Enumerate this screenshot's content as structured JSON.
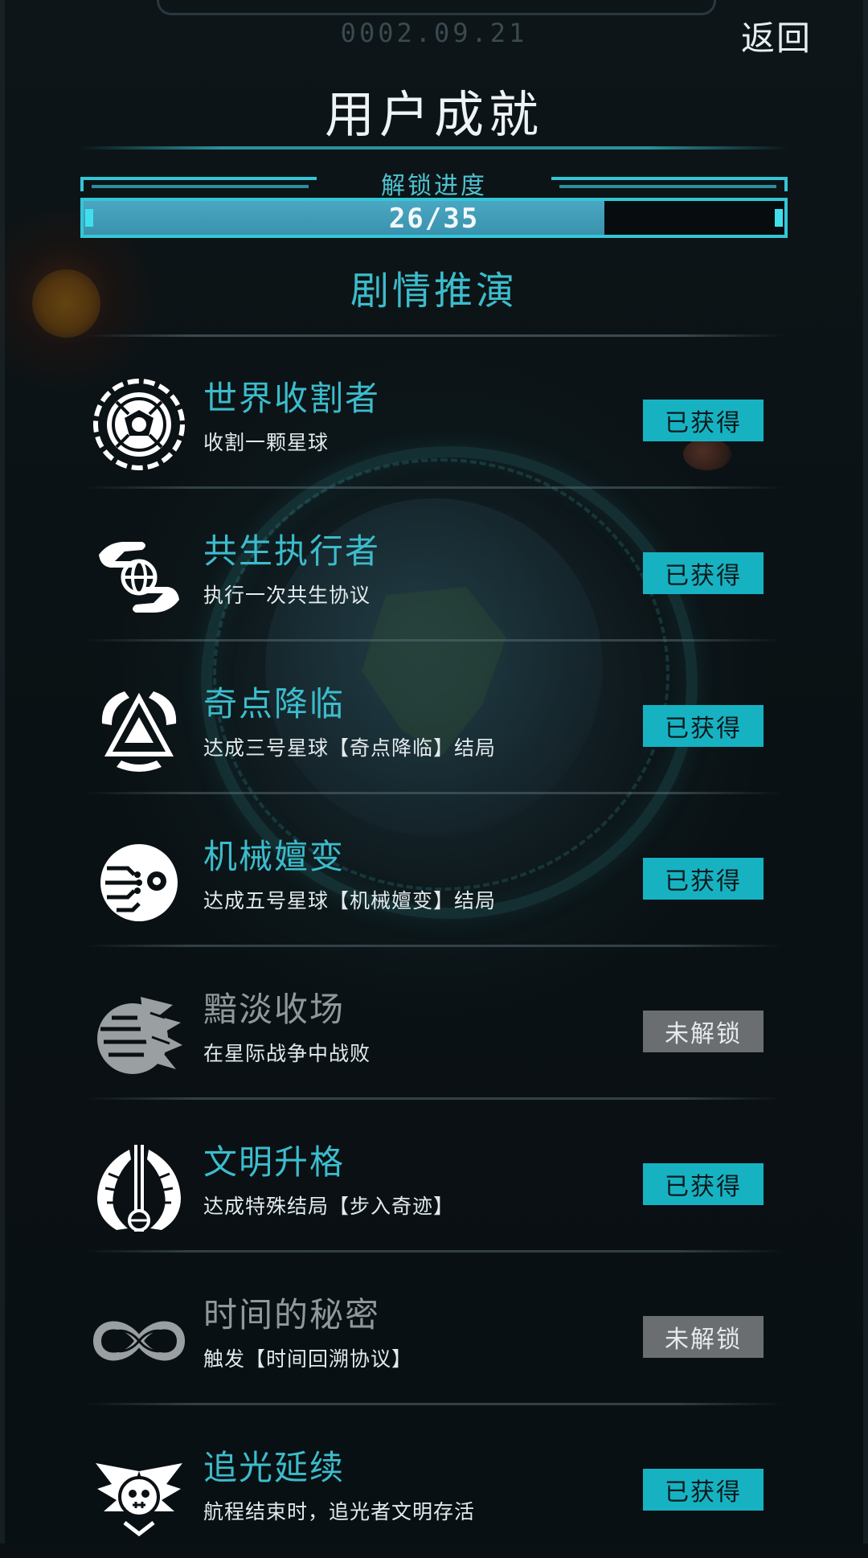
{
  "header": {
    "date": "0002.09.21",
    "back_label": "返回",
    "title": "用户成就"
  },
  "progress": {
    "label": "解锁进度",
    "text": "26/35",
    "unlocked": 26,
    "total": 35,
    "fill_color": "#3a92ae"
  },
  "section": {
    "title": "剧情推演"
  },
  "colors": {
    "accent": "#3cbccc",
    "obtained_badge": "#17b2c2",
    "locked_badge": "#6a6e70",
    "locked_text": "#8f999c"
  },
  "achievements": [
    {
      "name": "世界收割者",
      "desc": "收割一颗星球",
      "status": "已获得",
      "locked": false,
      "icon": "planet-reaper-icon"
    },
    {
      "name": "共生执行者",
      "desc": "执行一次共生协议",
      "status": "已获得",
      "locked": false,
      "icon": "hands-globe-icon"
    },
    {
      "name": "奇点降临",
      "desc": "达成三号星球【奇点降临】结局",
      "status": "已获得",
      "locked": false,
      "icon": "triangle-hands-icon"
    },
    {
      "name": "机械嬗变",
      "desc": "达成五号星球【机械嬗变】结局",
      "status": "已获得",
      "locked": false,
      "icon": "cyber-eye-icon"
    },
    {
      "name": "黯淡收场",
      "desc": "在星际战争中战败",
      "status": "未解锁",
      "locked": true,
      "icon": "broken-planet-icon"
    },
    {
      "name": "文明升格",
      "desc": "达成特殊结局【步入奇迹】",
      "status": "已获得",
      "locked": false,
      "icon": "winged-emblem-icon"
    },
    {
      "name": "时间的秘密",
      "desc": "触发【时间回溯协议】",
      "status": "未解锁",
      "locked": true,
      "icon": "infinity-icon"
    },
    {
      "name": "追光延续",
      "desc": "航程结束时，追光者文明存活",
      "status": "已获得",
      "locked": false,
      "icon": "winged-skull-icon"
    }
  ]
}
